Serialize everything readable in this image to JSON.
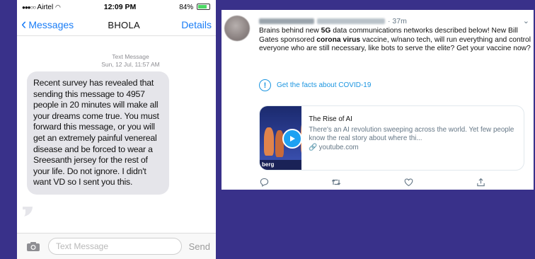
{
  "phone": {
    "status": {
      "carrier": "Airtel",
      "time": "12:09 PM",
      "battery": "84%"
    },
    "nav": {
      "back_label": "Messages",
      "contact": "BHOLA",
      "details_label": "Details"
    },
    "meta": {
      "type": "Text Message",
      "date": "Sun, 12 Jul, 11:57 AM"
    },
    "message": "Recent survey has revealed that sending this message to 4957 people in 20 minutes will make all your dreams come true. You must forward this message, or you will get an extremely painful venereal disease and be forced to wear a Sreesanth jersey for the rest of your life. Do not ignore. I didn't want VD so I sent you this.",
    "compose": {
      "placeholder": "Text Message",
      "send_label": "Send"
    }
  },
  "tweet": {
    "time": "· 37m",
    "text_parts": {
      "p1": "Brains behind new ",
      "b1": "5G",
      "p2": " data communications networks described below! New Bill Gates sponsored ",
      "b2": "corona virus",
      "p3": " vaccine, w/nano tech, will run everything and control everyone who are still necessary, like bots to serve the elite?  Get your vaccine now?"
    },
    "covid_link": "Get the facts about COVID-19",
    "card": {
      "title": "The Rise of AI",
      "description": "There's an AI revolution sweeping across the world. Yet few people know the real story about where thi...",
      "domain": "youtube.com",
      "thumb_label": "berg"
    },
    "icons": [
      "reply-icon",
      "retweet-icon",
      "like-icon",
      "share-icon"
    ]
  }
}
